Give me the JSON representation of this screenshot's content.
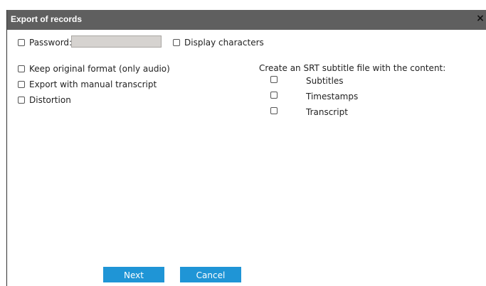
{
  "window": {
    "title": "Export of records",
    "close_icon": "×"
  },
  "options": {
    "password_label": "Password:",
    "password_value": "",
    "display_characters_label": "Display characters",
    "keep_original_label": "Keep original format (only audio)",
    "manual_transcript_label": "Export with manual transcript",
    "distortion_label": "Distortion"
  },
  "srt": {
    "heading": "Create an SRT subtitle file with the content:",
    "items": [
      "Subtitles",
      "Timestamps",
      "Transcript"
    ]
  },
  "buttons": {
    "next_label": "Next",
    "cancel_label": "Cancel"
  },
  "colors": {
    "titlebar_bg": "#5f5f5f",
    "button_bg": "#1f95d6",
    "password_field_bg": "#d6d3d0"
  }
}
